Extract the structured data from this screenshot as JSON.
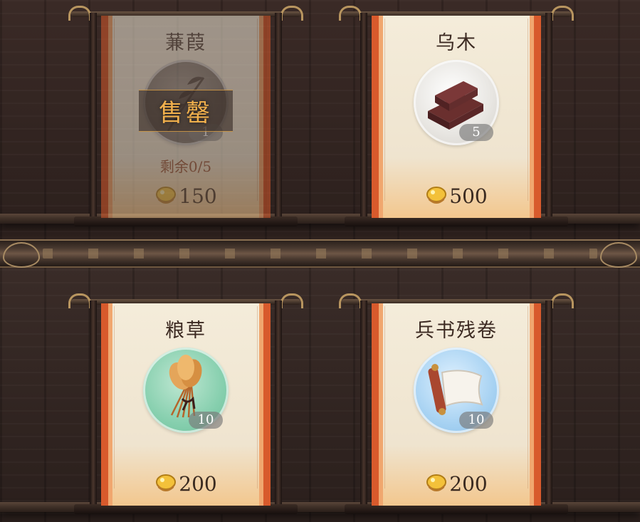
{
  "items": [
    {
      "name": "蒹葭",
      "count": "1",
      "price": "150",
      "sold_out_label": "售罄",
      "remaining": "剩余0/5",
      "icon": "reed-icon"
    },
    {
      "name": "乌木",
      "count": "5",
      "price": "500",
      "icon": "ebony-wood-icon"
    },
    {
      "name": "粮草",
      "count": "10",
      "price": "200",
      "icon": "grain-bundle-icon"
    },
    {
      "name": "兵书残卷",
      "count": "10",
      "price": "200",
      "icon": "war-scroll-icon"
    }
  ],
  "currency_icon": "gold-coin-icon"
}
